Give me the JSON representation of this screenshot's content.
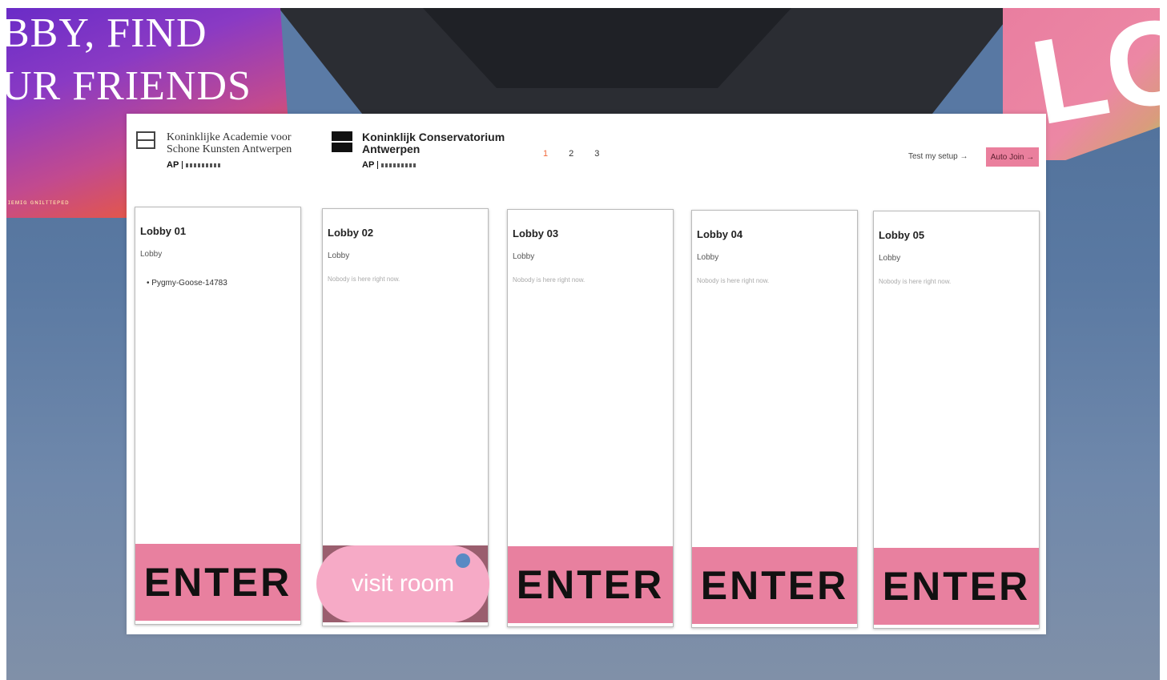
{
  "poster_left": {
    "line1": "BBY, FIND",
    "line2": "UR FRIENDS",
    "small": "ɪᴇᴍɪɢ ɢɴɪʟᴛᴛᴇᴘᴇᴅ"
  },
  "poster_right": {
    "big": "LO"
  },
  "header": {
    "logo1_line1": "Koninklijke Academie voor",
    "logo1_line2": "Schone Kunsten Antwerpen",
    "logo2_line1": "Koninklijk Conservatorium",
    "logo2_line2": "Antwerpen",
    "logo_ap": "AP",
    "pages": [
      "1",
      "2",
      "3"
    ],
    "test_setup": "Test my setup →",
    "auto_join": "Auto Join →"
  },
  "lobbies": [
    {
      "title": "Lobby 01",
      "subtitle": "Lobby",
      "participants": [
        "Pygmy-Goose-14783"
      ],
      "button": "ENTER"
    },
    {
      "title": "Lobby 02",
      "subtitle": "Lobby",
      "empty": "Nobody is here right now.",
      "button": "visit room"
    },
    {
      "title": "Lobby 03",
      "subtitle": "Lobby",
      "empty": "Nobody is here right now.",
      "button": "ENTER"
    },
    {
      "title": "Lobby 04",
      "subtitle": "Lobby",
      "empty": "Nobody is here right now.",
      "button": "ENTER"
    },
    {
      "title": "Lobby 05",
      "subtitle": "Lobby",
      "empty": "Nobody is here right now.",
      "button": "ENTER"
    }
  ],
  "colors": {
    "accent_pink": "#e8809f",
    "active_page": "#f06a3c",
    "visit_pink": "#f6aac6"
  }
}
